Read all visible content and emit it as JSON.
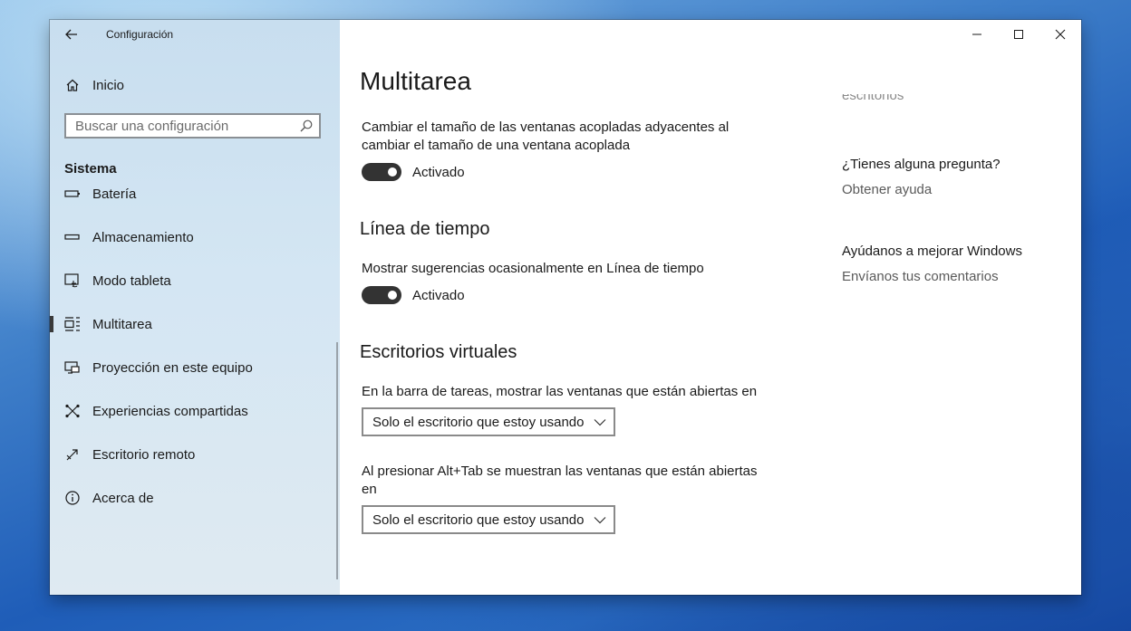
{
  "window": {
    "title": "Configuración"
  },
  "sidebar": {
    "home_label": "Inicio",
    "search": {
      "placeholder": "Buscar una configuración"
    },
    "section_title": "Sistema",
    "items": [
      {
        "label": "Batería",
        "icon": "battery-icon"
      },
      {
        "label": "Almacenamiento",
        "icon": "storage-icon"
      },
      {
        "label": "Modo tableta",
        "icon": "tablet-mode-icon"
      },
      {
        "label": "Multitarea",
        "icon": "multitasking-icon",
        "active": true
      },
      {
        "label": "Proyección en este equipo",
        "icon": "projection-icon"
      },
      {
        "label": "Experiencias compartidas",
        "icon": "shared-experiences-icon"
      },
      {
        "label": "Escritorio remoto",
        "icon": "remote-desktop-icon"
      },
      {
        "label": "Acerca de",
        "icon": "info-icon"
      }
    ]
  },
  "main": {
    "page_title": "Multitarea",
    "snap_resize": {
      "description": "Cambiar el tamaño de las ventanas acopladas adyacentes al cambiar el tamaño de una ventana acoplada",
      "toggle_label": "Activado",
      "toggle_on": true
    },
    "timeline": {
      "heading": "Línea de tiempo",
      "description": "Mostrar sugerencias ocasionalmente en Línea de tiempo",
      "toggle_label": "Activado",
      "toggle_on": true
    },
    "virtual_desktops": {
      "heading": "Escritorios virtuales",
      "taskbar_description": "En la barra de tareas, mostrar las ventanas que están abiertas en",
      "taskbar_value": "Solo el escritorio que estoy usando",
      "alttab_description": "Al presionar Alt+Tab se muestran las ventanas que están abiertas en",
      "alttab_value": "Solo el escritorio que estoy usando"
    }
  },
  "right_panel": {
    "faded_text": "escritorios",
    "question_heading": "¿Tienes alguna pregunta?",
    "help_link": "Obtener ayuda",
    "improve_heading": "Ayúdanos a mejorar Windows",
    "feedback_link": "Envíanos tus comentarios"
  },
  "colors": {
    "toggle_on": "#333333",
    "sidebar_bg": "#d4e6f3",
    "accent": "#3a3a3a"
  }
}
